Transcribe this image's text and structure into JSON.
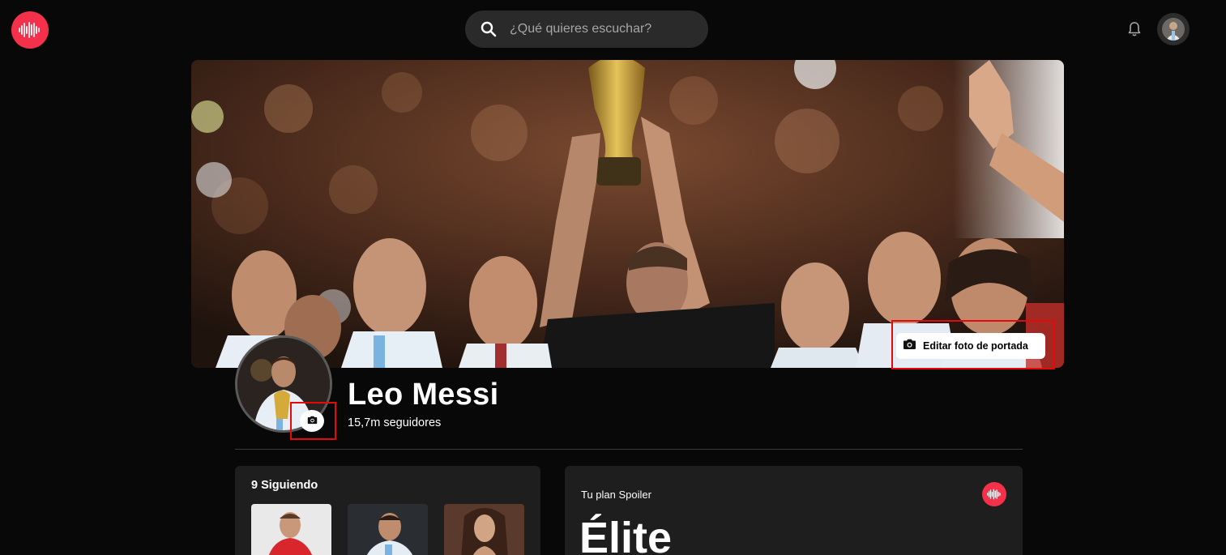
{
  "app": {
    "brand_color": "#f4304b",
    "logo_icon": "sound-wave-icon"
  },
  "header": {
    "search": {
      "placeholder": "¿Qué quieres escuchar?",
      "value": ""
    },
    "notifications_icon": "bell-icon",
    "user_avatar": "user-avatar"
  },
  "cover": {
    "edit_label": "Editar foto de portada",
    "edit_icon": "camera-icon"
  },
  "profile": {
    "name": "Leo Messi",
    "followers": "15,7m seguidores",
    "photo_edit_icon": "camera-icon"
  },
  "following": {
    "title": "9 Siguiendo",
    "items": [
      {
        "avatar": "goalkeeper-photo"
      },
      {
        "avatar": "player-photo"
      },
      {
        "avatar": "woman-photo"
      }
    ]
  },
  "plan": {
    "label": "Tu plan Spoiler",
    "name": "Élite"
  },
  "colors": {
    "background": "#080808",
    "card": "#1e1e1e",
    "highlight_border": "#e6090b"
  }
}
